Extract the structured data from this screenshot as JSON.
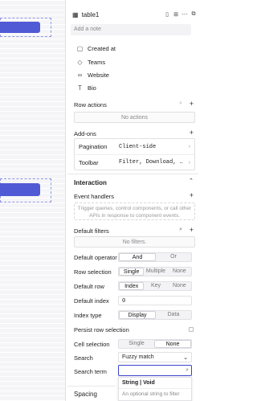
{
  "header": {
    "title": "table1"
  },
  "note_placeholder": "Add a note",
  "columns": [
    {
      "label": "Created at",
      "icon": "calendar-icon"
    },
    {
      "label": "Teams",
      "icon": "tag-icon"
    },
    {
      "label": "Website",
      "icon": "link-icon"
    },
    {
      "label": "Bio",
      "icon": "text-icon"
    }
  ],
  "row_actions": {
    "label": "Row actions",
    "empty": "No actions"
  },
  "addons": {
    "label": "Add-ons",
    "rows": [
      {
        "key": "Pagination",
        "value": "Client-side"
      },
      {
        "key": "Toolbar",
        "value": "Filter, Download, …"
      }
    ]
  },
  "interaction": {
    "title": "Interaction",
    "event_handlers": "Event handlers",
    "event_hint": "Trigger queries, control components, or call other APIs in response to component events."
  },
  "default_filters": {
    "label": "Default filters",
    "empty": "No filters."
  },
  "settings": {
    "default_operator": {
      "label": "Default operator",
      "options": [
        "And",
        "Or"
      ],
      "selected": 0
    },
    "row_selection": {
      "label": "Row selection",
      "options": [
        "Single",
        "Multiple",
        "None"
      ],
      "selected": 0
    },
    "default_row": {
      "label": "Default row",
      "options": [
        "Index",
        "Key",
        "None"
      ],
      "selected": 0
    },
    "default_index": {
      "label": "Default index",
      "value": "0"
    },
    "index_type": {
      "label": "Index type",
      "options": [
        "Display",
        "Data"
      ],
      "selected": 0
    },
    "persist": {
      "label": "Persist row selection"
    },
    "cell_selection": {
      "label": "Cell selection",
      "options": [
        "Single",
        "None"
      ],
      "selected": 1
    },
    "search": {
      "label": "Search",
      "value": "Fuzzy match"
    },
    "search_term": {
      "label": "Search term"
    }
  },
  "spacing": {
    "label": "Spacing"
  },
  "autocomplete": {
    "type": "String | Void",
    "desc": "An optional string to filter"
  }
}
